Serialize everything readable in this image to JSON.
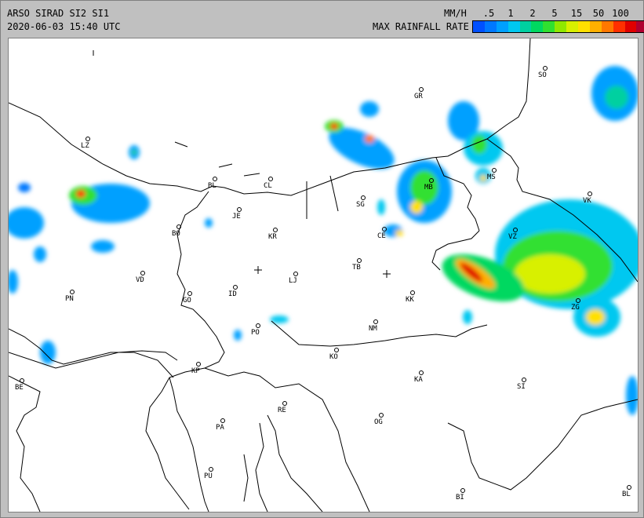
{
  "header": {
    "title": "ARSO SIRAD SI2 SI1",
    "timestamp": "2020-06-03 15:40 UTC",
    "unit": "MM/H",
    "rate_label": "MAX RAINFALL RATE"
  },
  "legend": {
    "ticks": [
      ".5",
      "1",
      "2",
      "5",
      "15",
      "50",
      "100"
    ],
    "colors": [
      "#0050ff",
      "#0078ff",
      "#00a0ff",
      "#00c8f0",
      "#00d0a0",
      "#00d860",
      "#30e030",
      "#90e800",
      "#d8f000",
      "#ffe000",
      "#ffb000",
      "#ff7800",
      "#ff3000",
      "#e00000",
      "#b00030",
      "#d000c8"
    ]
  },
  "map": {
    "cities": [
      {
        "code": "SO"
      },
      {
        "code": "GR"
      },
      {
        "code": "LZ"
      },
      {
        "code": "BL"
      },
      {
        "code": "CL"
      },
      {
        "code": "MB"
      },
      {
        "code": "MS"
      },
      {
        "code": "VK"
      },
      {
        "code": "JE"
      },
      {
        "code": "SG"
      },
      {
        "code": "BO"
      },
      {
        "code": "KR"
      },
      {
        "code": "CE"
      },
      {
        "code": "VZ"
      },
      {
        "code": "TB"
      },
      {
        "code": "VD"
      },
      {
        "code": "LJ"
      },
      {
        "code": "PN"
      },
      {
        "code": "GO"
      },
      {
        "code": "ID"
      },
      {
        "code": "KK"
      },
      {
        "code": "PO"
      },
      {
        "code": "NM"
      },
      {
        "code": "ZG"
      },
      {
        "code": "KO"
      },
      {
        "code": "KP"
      },
      {
        "code": "KA"
      },
      {
        "code": "SI"
      },
      {
        "code": "BE"
      },
      {
        "code": "RE"
      },
      {
        "code": "OG"
      },
      {
        "code": "PA"
      },
      {
        "code": "PU"
      },
      {
        "code": "BI"
      },
      {
        "code": "BL"
      }
    ]
  }
}
